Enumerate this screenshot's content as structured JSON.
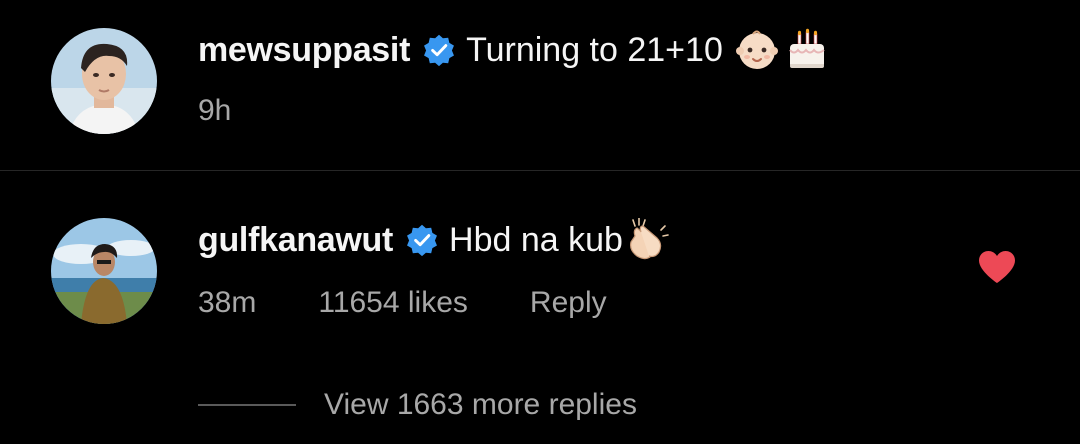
{
  "post": {
    "username": "mewsuppasit",
    "caption": "Turning to 21+10",
    "caption_emojis": [
      "baby-emoji",
      "cake-emoji"
    ],
    "time": "9h"
  },
  "comment": {
    "username": "gulfkanawut",
    "text": "Hbd na kub",
    "text_emoji": "clapping-hands-emoji",
    "time": "38m",
    "likes": "11654 likes",
    "reply_label": "Reply",
    "liked": true
  },
  "replies": {
    "label": "View 1663 more replies"
  },
  "colors": {
    "background": "#000000",
    "primary_text": "#f5f5f5",
    "secondary_text": "#a8a8a8",
    "verified_badge": "#3897f0",
    "heart": "#ed4956",
    "divider": "#262626"
  }
}
